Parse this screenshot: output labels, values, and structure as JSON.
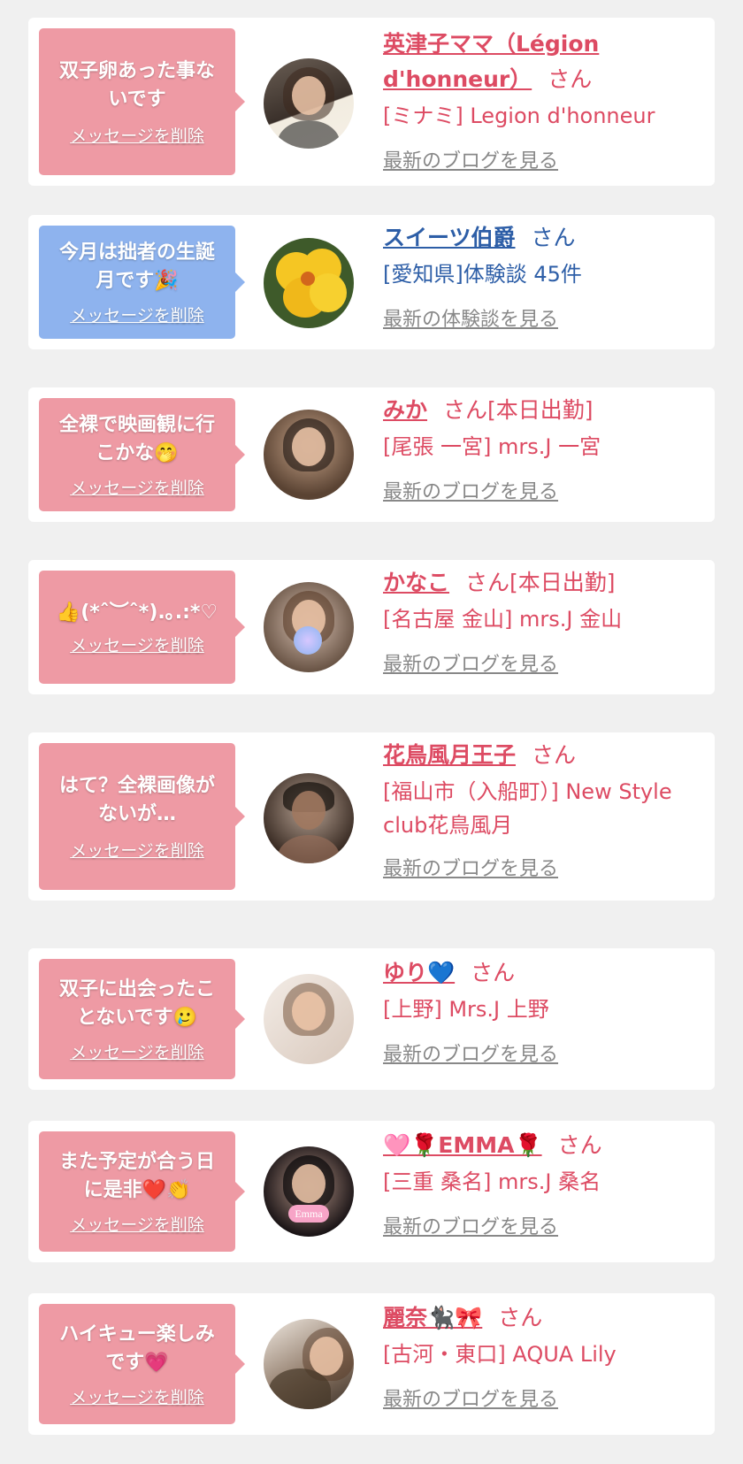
{
  "delete_label": "メッセージを削除",
  "san_label": "さん",
  "cards": [
    {
      "message_lines": [
        "双子卵あった事な",
        "いです"
      ],
      "name": "英津子ママ（Légion d'honneur）",
      "suffix": "",
      "location": "[ミナミ] Legion d'honneur",
      "blog_label": "最新のブログを見る"
    },
    {
      "message_lines": [
        "今月は拙者の生誕",
        "月です🎉"
      ],
      "name": "スイーツ伯爵",
      "suffix": "",
      "location": "[愛知県]体験談 45件",
      "blog_label": "最新の体験談を見る"
    },
    {
      "message_lines": [
        "全裸で映画観に行",
        "こかな🤭"
      ],
      "name": "みか",
      "suffix": "[本日出勤]",
      "location": "[尾張 一宮] mrs.J 一宮",
      "blog_label": "最新のブログを見る"
    },
    {
      "message_lines": [
        "👍(*ˆ︶ˆ*).｡.:*♡"
      ],
      "name": "かなこ",
      "suffix": "[本日出勤]",
      "location": "[名古屋 金山] mrs.J 金山",
      "blog_label": "最新のブログを見る"
    },
    {
      "message_lines": [
        "はて？全裸画像が",
        "ないが…"
      ],
      "name": "花鳥風月王子",
      "suffix": "",
      "location": "[福山市（入船町）] New Style club花鳥風月",
      "blog_label": "最新のブログを見る"
    },
    {
      "message_lines": [
        "双子に出会ったこ",
        "とないです🥲"
      ],
      "name": "ゆり💙",
      "suffix": "",
      "location": "[上野] Mrs.J 上野",
      "blog_label": "最新のブログを見る"
    },
    {
      "message_lines": [
        "また予定が合う日",
        "に是非❤️👏"
      ],
      "name": "🩷🌹EMMA🌹",
      "suffix": "",
      "location": "[三重 桑名] mrs.J 桑名",
      "blog_label": "最新のブログを見る",
      "avatar_badge": "Emma"
    },
    {
      "message_lines": [
        "ハイキュー楽しみ",
        "です💗"
      ],
      "name": "麗奈🐈‍⬛🎀",
      "suffix": "",
      "location": "[古河・東口] AQUA Lily",
      "blog_label": "最新のブログを見る"
    }
  ],
  "colors": {
    "page_bg": "#f0f0f0",
    "card_bg": "#ffffff",
    "pink_bubble": "#ee9aa4",
    "blue_bubble": "#8eb3ee",
    "pink_text": "#dd4b63",
    "blue_text": "#2d5ea7",
    "link_gray": "#888888"
  }
}
